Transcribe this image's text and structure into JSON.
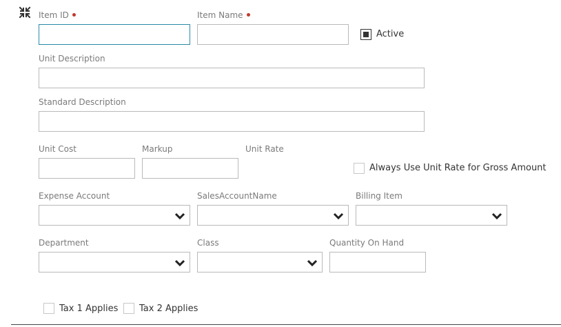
{
  "form": {
    "item_id": {
      "label": "Item ID",
      "value": ""
    },
    "item_name": {
      "label": "Item Name",
      "value": ""
    },
    "active": {
      "label": "Active",
      "checked": true
    },
    "unit_description": {
      "label": "Unit Description",
      "value": ""
    },
    "standard_description": {
      "label": "Standard Description",
      "value": ""
    },
    "unit_cost": {
      "label": "Unit Cost",
      "value": ""
    },
    "markup": {
      "label": "Markup",
      "value": ""
    },
    "unit_rate": {
      "label": "Unit Rate"
    },
    "always_use_unit_rate": {
      "label": "Always Use Unit Rate for Gross Amount",
      "checked": false
    },
    "expense_account": {
      "label": "Expense Account",
      "value": ""
    },
    "sales_account_name": {
      "label": "SalesAccountName",
      "value": ""
    },
    "billing_item": {
      "label": "Billing Item",
      "value": ""
    },
    "department": {
      "label": "Department",
      "value": ""
    },
    "class": {
      "label": "Class",
      "value": ""
    },
    "quantity_on_hand": {
      "label": "Quantity On Hand",
      "value": ""
    },
    "tax1": {
      "label": "Tax 1 Applies",
      "checked": false
    },
    "tax2": {
      "label": "Tax 2 Applies",
      "checked": false
    }
  },
  "icons": {
    "collapse": "collapse-arrows-icon",
    "dropdown": "chevron-down-icon"
  },
  "colors": {
    "required": "#c0392b",
    "focus": "#2a8aa6"
  }
}
